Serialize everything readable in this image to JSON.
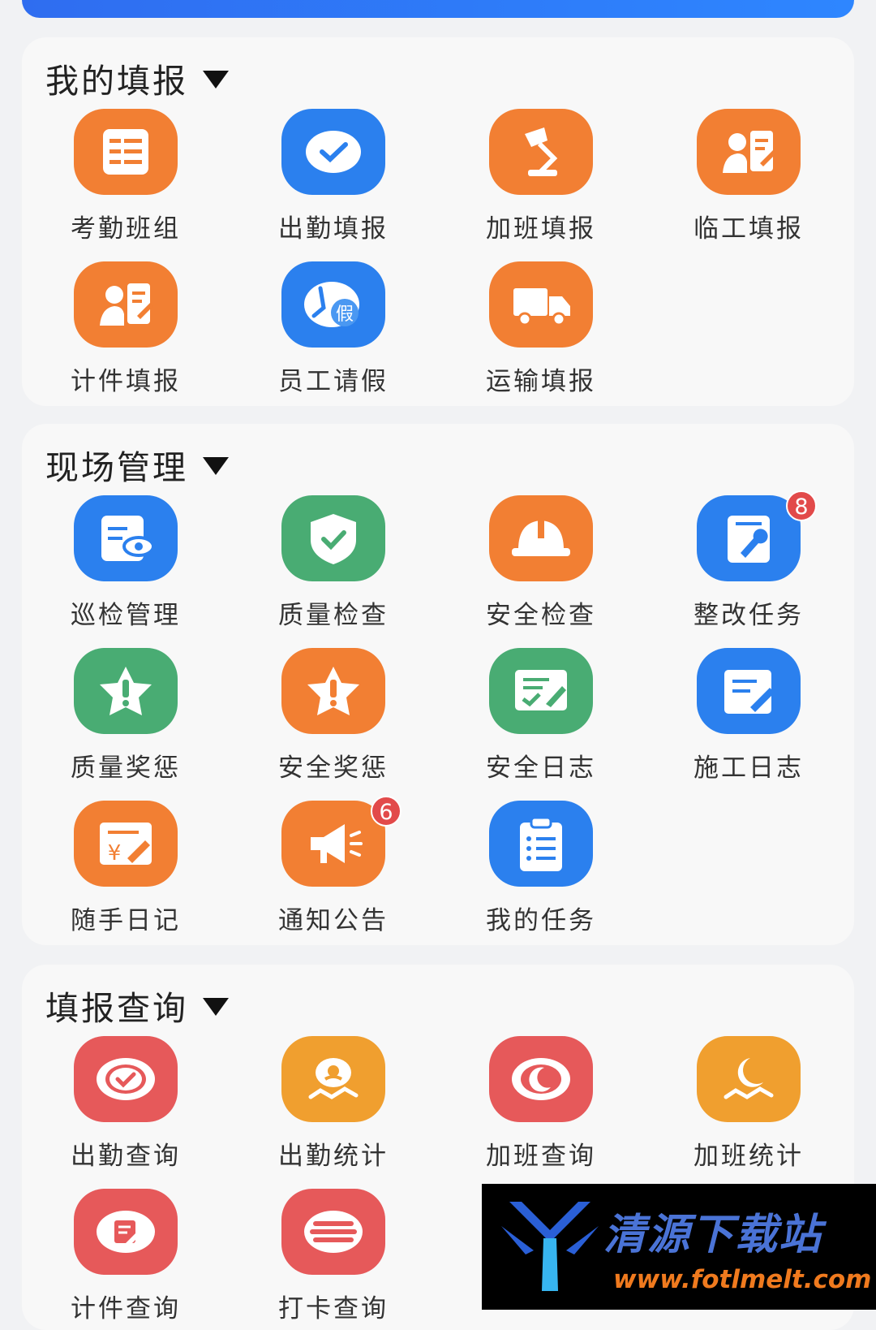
{
  "sections": {
    "report": {
      "title": "我的填报",
      "items": [
        {
          "label": "考勤班组",
          "icon": "roster-icon",
          "color": "#f27f33"
        },
        {
          "label": "出勤填报",
          "icon": "check-circle-icon",
          "color": "#2b80ee"
        },
        {
          "label": "加班填报",
          "icon": "desk-lamp-icon",
          "color": "#f27f33"
        },
        {
          "label": "临工填报",
          "icon": "worker-form-icon",
          "color": "#f27f33"
        },
        {
          "label": "计件填报",
          "icon": "worker-form-icon",
          "color": "#f27f33"
        },
        {
          "label": "员工请假",
          "icon": "clock-leave-icon",
          "color": "#2b80ee",
          "icon_text": "假"
        },
        {
          "label": "运输填报",
          "icon": "truck-icon",
          "color": "#f27f33"
        }
      ]
    },
    "site": {
      "title": "现场管理",
      "items": [
        {
          "label": "巡检管理",
          "icon": "inspection-eye-icon",
          "color": "#2b80ee"
        },
        {
          "label": "质量检查",
          "icon": "shield-check-icon",
          "color": "#49ac73"
        },
        {
          "label": "安全检查",
          "icon": "hard-hat-icon",
          "color": "#f27f33"
        },
        {
          "label": "整改任务",
          "icon": "wrench-doc-icon",
          "color": "#2b80ee",
          "badge": "8"
        },
        {
          "label": "质量奖惩",
          "icon": "star-alert-icon",
          "color": "#49ac73"
        },
        {
          "label": "安全奖惩",
          "icon": "star-alert-icon",
          "color": "#f27f33"
        },
        {
          "label": "安全日志",
          "icon": "log-check-icon",
          "color": "#49ac73"
        },
        {
          "label": "施工日志",
          "icon": "doc-pen-icon",
          "color": "#2b80ee"
        },
        {
          "label": "随手日记",
          "icon": "yen-note-icon",
          "color": "#f27f33"
        },
        {
          "label": "通知公告",
          "icon": "megaphone-icon",
          "color": "#f27f33",
          "badge": "6"
        },
        {
          "label": "我的任务",
          "icon": "clipboard-list-icon",
          "color": "#2b80ee"
        }
      ]
    },
    "query": {
      "title": "填报查询",
      "items": [
        {
          "label": "出勤查询",
          "icon": "check-badge-icon",
          "color": "#e6595a"
        },
        {
          "label": "出勤统计",
          "icon": "person-stat-icon",
          "color": "#f09f2f"
        },
        {
          "label": "加班查询",
          "icon": "moon-badge-icon",
          "color": "#e6595a"
        },
        {
          "label": "加班统计",
          "icon": "moon-stat-icon",
          "color": "#f09f2f"
        },
        {
          "label": "计件查询",
          "icon": "note-badge-icon",
          "color": "#e6595a"
        },
        {
          "label": "打卡查询",
          "icon": "menu-badge-icon",
          "color": "#e6595a"
        }
      ]
    }
  },
  "watermark": {
    "title": "清源下载站",
    "url": "www.fotlmelt.com"
  }
}
